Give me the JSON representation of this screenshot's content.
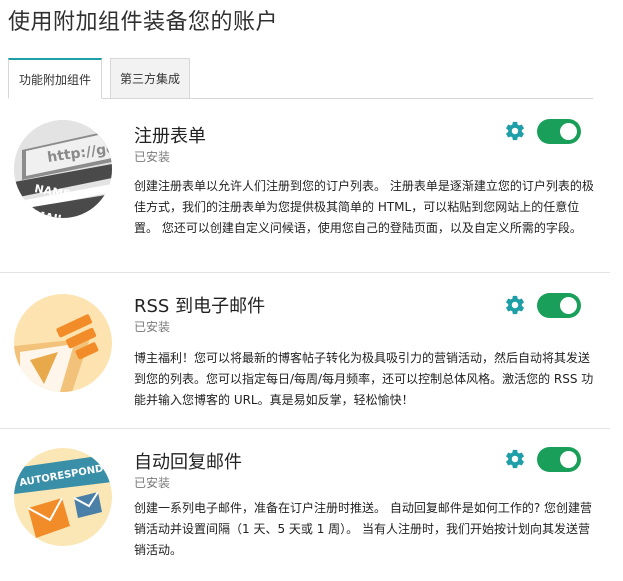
{
  "page": {
    "title": "使用附加组件装备您的账户"
  },
  "tabs": [
    {
      "label": "功能附加组件",
      "active": true
    },
    {
      "label": "第三方集成",
      "active": false
    }
  ],
  "addons": [
    {
      "name": "注册表单",
      "status": "已安装",
      "enabled": true,
      "description": "创建注册表单以允许人们注册到您的订户列表。 注册表单是逐渐建立您的订户列表的极佳方式，我们的注册表单为您提供极其简单的 HTML，可以粘贴到您网站上的任意位置。 您还可以创建自定义问候语，使用您自己的登陆页面，以及自定义所需的字段。",
      "logo": {
        "icon": "browser-form-icon",
        "texts": [
          "http://ge",
          "NAME",
          "EMAIL"
        ]
      }
    },
    {
      "name": "RSS 到电子邮件",
      "status": "已安装",
      "enabled": true,
      "description": "博主福利！您可以将最新的博客帖子转化为极具吸引力的营销活动，然后自动将其发送到您的列表。您可以指定每日/每周/每月频率，还可以控制总体风格。激活您的 RSS 功能并输入您博客的 URL。真是易如反掌，轻松愉快！",
      "logo": {
        "icon": "rss-paper-plane-icon"
      }
    },
    {
      "name": "自动回复邮件",
      "status": "已安装",
      "enabled": true,
      "description": "创建一系列电子邮件，准备在订户注册时推送。 自动回复邮件是如何工作的? 您创建营销活动并设置间隔（1 天、5 天或 1 周）。 当有人注册时，我们开始按计划向其发送营销活动。",
      "logo": {
        "icon": "autoresponder-envelopes-icon",
        "texts": [
          "AUTORESPOND"
        ]
      }
    }
  ],
  "colors": {
    "accent": "#1e9ea6",
    "toggle_on": "#1a9f5a",
    "gear": "#1e9ea6"
  }
}
